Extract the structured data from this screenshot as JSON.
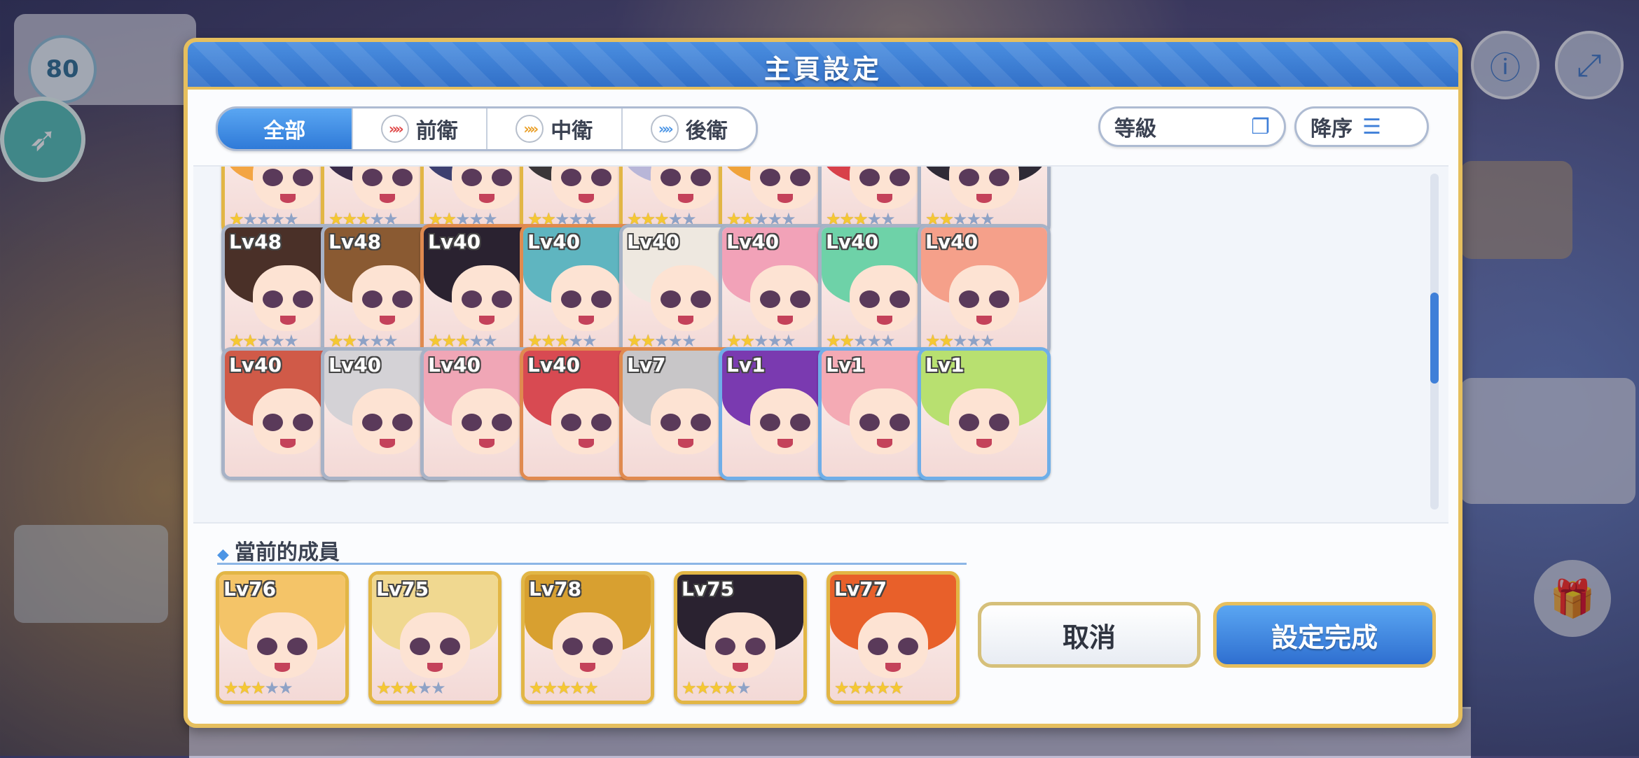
{
  "background": {
    "player_level": "80",
    "rocket_icon": "rocket-icon"
  },
  "dialog": {
    "title": "主頁設定",
    "tabs": [
      {
        "label": "全部",
        "icon": null,
        "active": true
      },
      {
        "label": "前衛",
        "icon": "front-role-icon",
        "color": "#e04848"
      },
      {
        "label": "中衛",
        "icon": "middle-role-icon",
        "color": "#eaa02a"
      },
      {
        "label": "後衛",
        "icon": "back-role-icon",
        "color": "#4c95e5"
      }
    ],
    "sort_field": "等級",
    "sort_order": "降序",
    "characters": [
      {
        "lv": "",
        "stars": 1,
        "frame": "gold",
        "hair": "#f3a543"
      },
      {
        "lv": "",
        "stars": 3,
        "frame": "gold",
        "hair": "#3a2c4a"
      },
      {
        "lv": "",
        "stars": 2,
        "frame": "gold",
        "hair": "#3d4070"
      },
      {
        "lv": "",
        "stars": 2,
        "frame": "gold",
        "hair": "#3a3638"
      },
      {
        "lv": "",
        "stars": 3,
        "frame": "gold",
        "hair": "#b8b6d8"
      },
      {
        "lv": "",
        "stars": 2,
        "frame": "gold",
        "hair": "#f0a33a"
      },
      {
        "lv": "",
        "stars": 3,
        "frame": "silver",
        "hair": "#d8404a"
      },
      {
        "lv": "",
        "stars": 2,
        "frame": "silver",
        "hair": "#2e2a36"
      },
      {
        "lv": "Lv48",
        "stars": 2,
        "frame": "silver",
        "hair": "#4a3028"
      },
      {
        "lv": "Lv48",
        "stars": 2,
        "frame": "silver",
        "hair": "#8a5a32"
      },
      {
        "lv": "Lv40",
        "stars": 3,
        "frame": "copper",
        "hair": "#2a2230"
      },
      {
        "lv": "Lv40",
        "stars": 3,
        "frame": "copper",
        "hair": "#5fb5c0"
      },
      {
        "lv": "Lv40",
        "stars": 2,
        "frame": "silver",
        "hair": "#eee8e0"
      },
      {
        "lv": "Lv40",
        "stars": 2,
        "frame": "silver",
        "hair": "#f2a2b8"
      },
      {
        "lv": "Lv40",
        "stars": 2,
        "frame": "silver",
        "hair": "#6ed2a8"
      },
      {
        "lv": "Lv40",
        "stars": 2,
        "frame": "silver",
        "hair": "#f5a08a"
      },
      {
        "lv": "Lv40",
        "stars": 0,
        "frame": "silver",
        "hair": "#d05a48"
      },
      {
        "lv": "Lv40",
        "stars": 0,
        "frame": "silver",
        "hair": "#d4d2d6"
      },
      {
        "lv": "Lv40",
        "stars": 0,
        "frame": "silver",
        "hair": "#f0a6b6"
      },
      {
        "lv": "Lv40",
        "stars": 0,
        "frame": "copper",
        "hair": "#d84a52"
      },
      {
        "lv": "Lv7",
        "stars": 0,
        "frame": "copper",
        "hair": "#c8c6c8"
      },
      {
        "lv": "Lv1",
        "stars": 0,
        "frame": "blue",
        "hair": "#7a3ab0"
      },
      {
        "lv": "Lv1",
        "stars": 0,
        "frame": "blue",
        "hair": "#f4aab4"
      },
      {
        "lv": "Lv1",
        "stars": 0,
        "frame": "blue",
        "hair": "#b8e070"
      }
    ],
    "members_label": "當前的成員",
    "members": [
      {
        "lv": "Lv76",
        "stars": 3,
        "hair": "#f4c468"
      },
      {
        "lv": "Lv75",
        "stars": 3,
        "hair": "#f0d890"
      },
      {
        "lv": "Lv78",
        "stars": 5,
        "hair": "#d8a030"
      },
      {
        "lv": "Lv75",
        "stars": 4,
        "hair": "#2a2230"
      },
      {
        "lv": "Lv77",
        "stars": 5,
        "hair": "#e8602a"
      }
    ],
    "cancel_label": "取消",
    "confirm_label": "設定完成"
  }
}
